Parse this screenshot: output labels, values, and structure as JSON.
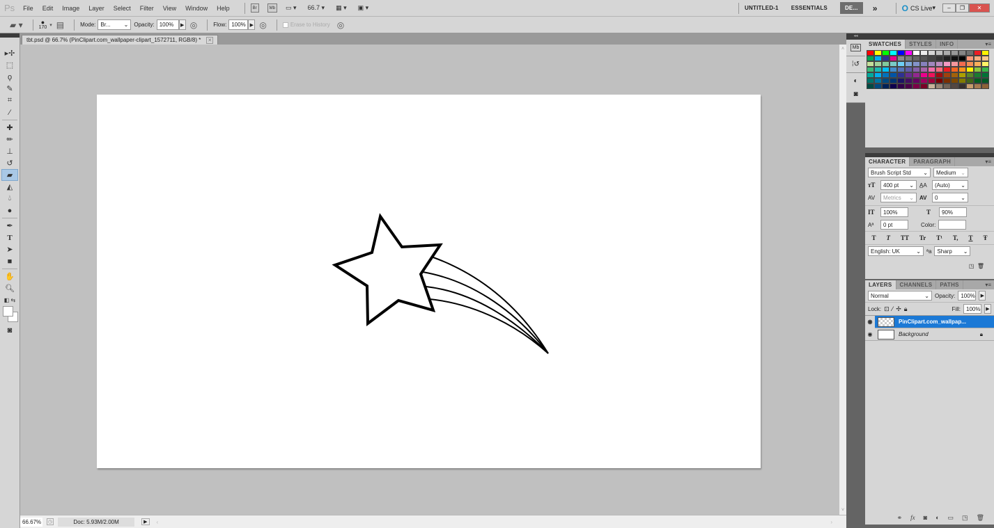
{
  "app": {
    "logo": "Ps"
  },
  "menu": [
    "File",
    "Edit",
    "Image",
    "Layer",
    "Select",
    "Filter",
    "View",
    "Window",
    "Help"
  ],
  "appbar": {
    "bridge": "Br",
    "mini_bridge": "Mb",
    "zoom": "66.7"
  },
  "workspaces": {
    "untitled": "UNTITLED-1",
    "essentials": "ESSENTIALS",
    "active": "DE...",
    "more": "»",
    "cslive": "CS Live"
  },
  "options": {
    "brush_size": "170",
    "mode_label": "Mode:",
    "mode_value": "Br...",
    "opacity_label": "Opacity:",
    "opacity_value": "100%",
    "flow_label": "Flow:",
    "flow_value": "100%",
    "erase_history": "Erase to History"
  },
  "document": {
    "tab_title": "tbt.psd @ 66.7% (PinClipart.com_wallpaper-clipart_1572711, RGB/8) *"
  },
  "status": {
    "zoom": "66.67%",
    "doc": "Doc: 5.93M/2.00M"
  },
  "swatches_panel": {
    "tabs": [
      "SWATCHES",
      "STYLES",
      "INFO"
    ],
    "rows": [
      [
        "#ff0000",
        "#ffff00",
        "#00ff00",
        "#00ffff",
        "#0000ff",
        "#ff00ff",
        "#ffffff",
        "#ebebeb",
        "#d6d6d6",
        "#c2c2c2",
        "#adadad",
        "#999999",
        "#858585",
        "#707070",
        "#ed1c24",
        "#fff200"
      ],
      [
        "#00a651",
        "#00aeef",
        "#2e3192",
        "#ec008c",
        "#8a8a8a",
        "#7a7a7a",
        "#666666",
        "#555555",
        "#444444",
        "#333333",
        "#222222",
        "#111111",
        "#000000",
        "#f7977a",
        "#f9ad81",
        "#fdc68a"
      ],
      [
        "#c4df9b",
        "#a3d39c",
        "#82ca9c",
        "#7accc8",
        "#6dcff6",
        "#7da7d9",
        "#8393ca",
        "#8781bd",
        "#a187be",
        "#bc8dbf",
        "#f49ac2",
        "#f6989d",
        "#f26c4f",
        "#f68e55",
        "#fbaf5c",
        "#fff467"
      ],
      [
        "#3cb878",
        "#1cbbb4",
        "#00bff3",
        "#448ccb",
        "#5674b9",
        "#605ca8",
        "#8560a8",
        "#a864a8",
        "#f06eaa",
        "#f26d7d",
        "#ed1c24",
        "#f26522",
        "#f7941d",
        "#fff200",
        "#8dc73f",
        "#39b54a"
      ],
      [
        "#00a99d",
        "#00aeef",
        "#0072bc",
        "#0054a6",
        "#2e3192",
        "#662d91",
        "#92278f",
        "#ec008c",
        "#ed145b",
        "#9e0b0f",
        "#a0410d",
        "#a3620a",
        "#aba000",
        "#598527",
        "#197b30",
        "#007236"
      ],
      [
        "#00746b",
        "#0076a3",
        "#004a80",
        "#003471",
        "#1b1464",
        "#440e62",
        "#630460",
        "#9e005d",
        "#9e0039",
        "#790000",
        "#7b2e00",
        "#7d4900",
        "#827b00",
        "#406618",
        "#005e20",
        "#005826"
      ],
      [
        "#004a43",
        "#004a80",
        "#002157",
        "#0d004c",
        "#32004b",
        "#4b0049",
        "#7b0046",
        "#7a0026",
        "#c7b299",
        "#998675",
        "#736357",
        "#534741",
        "#362f2d",
        "#c69c6d",
        "#a67c52",
        "#8c6239"
      ]
    ]
  },
  "character_panel": {
    "tabs": [
      "CHARACTER",
      "PARAGRAPH"
    ],
    "font_family": "Brush Script Std",
    "font_style": "Medium",
    "size": "400 pt",
    "leading": "(Auto)",
    "kerning": "Metrics",
    "tracking": "0",
    "vscale": "100%",
    "hscale": "90%",
    "baseline": "0 pt",
    "color_label": "Color:",
    "styles": [
      "T",
      "T",
      "TT",
      "Tr",
      "T¹",
      "T,",
      "T",
      "Ŧ"
    ],
    "language": "English: UK",
    "aa_label": "ªa",
    "antialias": "Sharp"
  },
  "layers_panel": {
    "tabs": [
      "LAYERS",
      "CHANNELS",
      "PATHS"
    ],
    "blend_mode": "Normal",
    "opacity_label": "Opacity:",
    "opacity": "100%",
    "lock_label": "Lock:",
    "fill_label": "Fill:",
    "fill": "100%",
    "layers": [
      {
        "name": "PinClipart.com_wallpap...",
        "selected": true,
        "locked": false
      },
      {
        "name": "Background",
        "selected": false,
        "locked": true
      }
    ]
  }
}
